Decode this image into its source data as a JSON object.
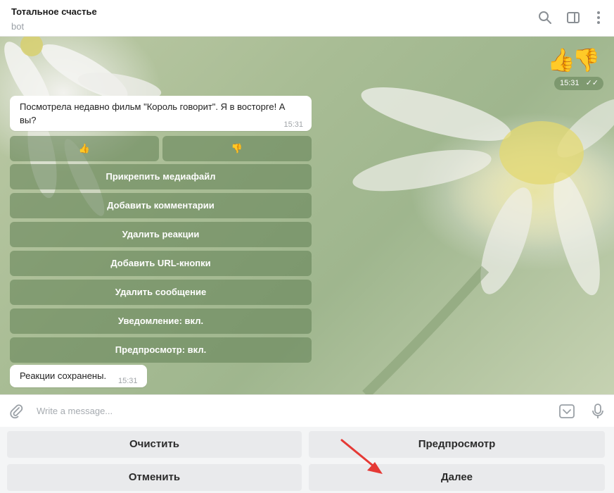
{
  "header": {
    "title": "Тотальное счастье",
    "subtitle": "bot",
    "icons": [
      "search-icon",
      "sidebar-icon",
      "more-icon"
    ]
  },
  "chat": {
    "sticker": {
      "emoji": "👍👎",
      "time": "15:31",
      "checks": "✓✓"
    },
    "message": {
      "text_line1": "Посмотрела недавно фильм \"Король говорит\". Я в восторге! А",
      "text_line2": "вы?",
      "time": "15:31"
    },
    "reactions": {
      "like": "👍",
      "dislike": "👎"
    },
    "inline_buttons": [
      "Прикрепить медиафайл",
      "Добавить комментарии",
      "Удалить реакции",
      "Добавить URL-кнопки",
      "Удалить сообщение",
      "Уведомление: вкл.",
      "Предпросмотр: вкл."
    ],
    "saved_message": {
      "text": "Реакции сохранены.",
      "time": "15:31"
    }
  },
  "input": {
    "placeholder": "Write a message..."
  },
  "reply_keyboard": {
    "clear": "Очистить",
    "preview": "Предпросмотр",
    "cancel": "Отменить",
    "next": "Далее"
  },
  "colors": {
    "accent_arrow": "#e53935",
    "inline_button": "#60805a",
    "chat_bg": "#a9bd95"
  }
}
